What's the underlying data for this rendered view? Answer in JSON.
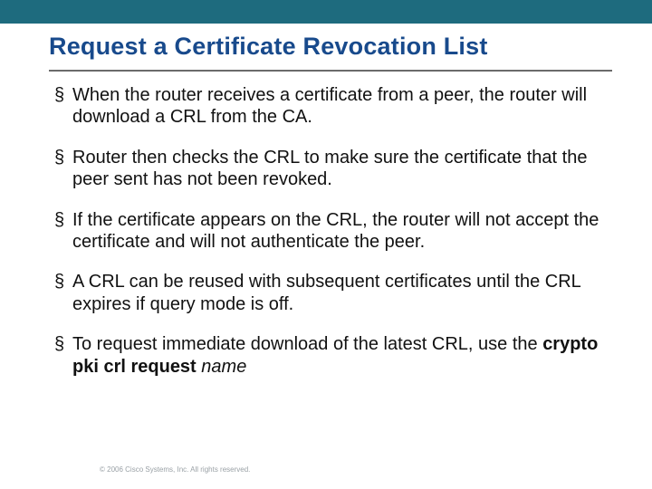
{
  "title": "Request a Certificate Revocation List",
  "bullets": {
    "b1": "When the router receives a certificate from a peer, the router will download a CRL from the CA.",
    "b2": "Router then checks the CRL to make sure the certificate that the peer sent has not been revoked.",
    "b3": "If the certificate appears on the CRL, the router will not accept the certificate and will not authenticate the peer.",
    "b4": "A CRL can be reused with subsequent certificates until the CRL expires if query mode is off.",
    "b5_pre": "To request immediate download of the latest CRL, use the ",
    "b5_cmd": "crypto pki crl request",
    "b5_space": " ",
    "b5_arg": "name"
  },
  "footer": "© 2006 Cisco Systems, Inc. All rights reserved."
}
